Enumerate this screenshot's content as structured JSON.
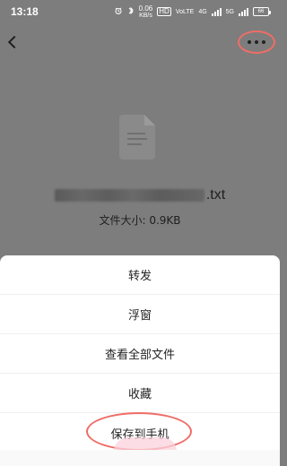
{
  "status_bar": {
    "time": "13:18",
    "network_speed_value": "0.06",
    "network_speed_unit": "KB/s",
    "hd_label": "HD",
    "volte_label": "VoLTE",
    "signal_label_1": "4G",
    "signal_label_2": "5G",
    "battery": "66",
    "icons": [
      "alarm-icon",
      "bluetooth-icon",
      "signal-icon",
      "battery-icon"
    ]
  },
  "header": {
    "back_icon": "chevron-left-icon",
    "more_icon": "ellipsis-icon"
  },
  "file": {
    "name_extension": ".txt",
    "size_text": "文件大小: 0.9KB"
  },
  "menu": {
    "items": [
      {
        "label": "转发"
      },
      {
        "label": "浮窗"
      },
      {
        "label": "查看全部文件"
      },
      {
        "label": "收藏"
      },
      {
        "label": "保存到手机"
      }
    ]
  },
  "colors": {
    "background": "#7d7d7d",
    "sheet": "#ffffff",
    "highlight": "#ef6d66"
  }
}
